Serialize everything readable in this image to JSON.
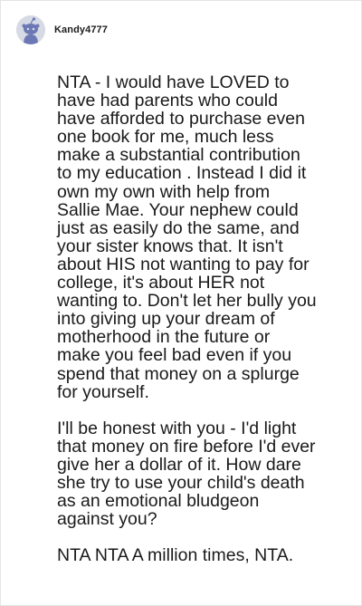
{
  "comment": {
    "author": "Kandy4777",
    "avatar_icon": "reddit-snoo-avatar-icon",
    "paragraphs": [
      "NTA - I would have LOVED to\nhave had parents who could\nhave afforded to purchase even\none book for me, much less\nmake a substantial contribution\nto my education . Instead I did it\nown my own with help from\nSallie Mae. Your nephew could\njust as easily do the same, and\nyour sister knows that. It isn't\nabout HIS not wanting to pay for\ncollege, it's about HER not\nwanting to. Don't let her bully you\ninto giving up your dream of\nmotherhood in the future or\nmake you feel bad even if you\nspend that money on a splurge\nfor yourself.",
      "I'll be honest with you - I'd light\nthat money on fire before I'd ever\ngive her a dollar of it. How dare\nshe try to use your child's death\nas an emotional bludgeon\nagainst you?",
      "NTA NTA A million times, NTA."
    ]
  },
  "colors": {
    "avatar_bg": "#d6dae4",
    "avatar_figure": "#6b78b4",
    "text": "#1a1a1a",
    "border": "#e4e4e4"
  }
}
